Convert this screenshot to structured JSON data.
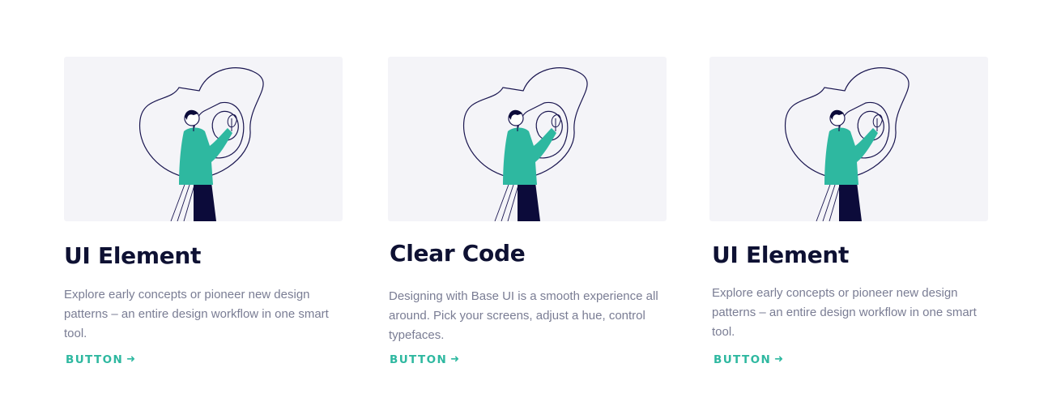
{
  "colors": {
    "title": "#0e1133",
    "body_text": "#7a7d94",
    "accent": "#2eb8a0",
    "illustration_background": "#f4f4f8",
    "line_art": "#1a1650",
    "pants": "#0c0b3a"
  },
  "cards": [
    {
      "illustration": "person-holding-lightbulb-illustration",
      "title": "UI Element",
      "description": "Explore early concepts or pioneer new design patterns – an entire design workflow in one smart tool.",
      "button_label": "BUTTON",
      "button_icon": "arrow-right-icon",
      "arrow": "➜"
    },
    {
      "illustration": "person-holding-lightbulb-illustration",
      "title": "Clear Code",
      "description": "Designing with Base UI is a smooth experience all around. Pick your screens, adjust a hue, control typefaces.",
      "button_label": "BUTTON",
      "button_icon": "arrow-right-icon",
      "arrow": "➜"
    },
    {
      "illustration": "person-holding-lightbulb-illustration",
      "title": "UI Element",
      "description": "Explore early concepts or pioneer new design patterns – an entire design workflow in one smart tool.",
      "button_label": "BUTTON",
      "button_icon": "arrow-right-icon",
      "arrow": "➜"
    }
  ]
}
